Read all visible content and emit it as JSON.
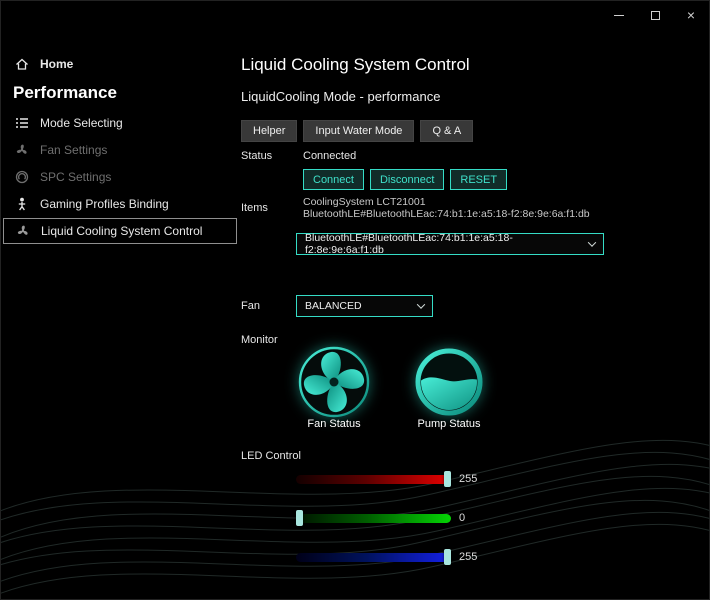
{
  "window": {
    "controls": {
      "minimize": "minimize",
      "maximize": "maximize",
      "close": "×"
    }
  },
  "sidebar": {
    "home_label": "Home",
    "section_title": "Performance",
    "items": [
      {
        "label": "Mode Selecting",
        "state": "normal"
      },
      {
        "label": "Fan Settings",
        "state": "disabled"
      },
      {
        "label": "SPC Settings",
        "state": "disabled"
      },
      {
        "label": "Gaming Profiles Binding",
        "state": "normal"
      },
      {
        "label": "Liquid Cooling System Control",
        "state": "selected"
      }
    ]
  },
  "main": {
    "title": "Liquid Cooling System Control",
    "subtitle": "LiquidCooling Mode - performance",
    "toolbar": {
      "helper": "Helper",
      "input_water_mode": "Input Water Mode",
      "qa": "Q & A"
    },
    "status": {
      "label": "Status",
      "value": "Connected",
      "connect": "Connect",
      "disconnect": "Disconnect",
      "reset": "RESET"
    },
    "items": {
      "label": "Items",
      "line1": "CoolingSystem LCT21001",
      "line2": "BluetoothLE#BluetoothLEac:74:b1:1e:a5:18-f2:8e:9e:6a:f1:db",
      "selected_device": "BluetoothLE#BluetoothLEac:74:b1:1e:a5:18-f2:8e:9e:6a:f1:db"
    },
    "fan": {
      "label": "Fan",
      "selected": "BALANCED"
    },
    "monitor": {
      "label": "Monitor",
      "fan_status_label": "Fan Status",
      "pump_status_label": "Pump Status"
    },
    "led": {
      "label": "LED Control",
      "sliders": [
        {
          "channel": "red",
          "value": 255,
          "max": 255
        },
        {
          "channel": "green",
          "value": 0,
          "max": 255
        },
        {
          "channel": "blue",
          "value": 255,
          "max": 255
        }
      ]
    }
  },
  "colors": {
    "accent": "#35dcc6",
    "background": "#000000",
    "button_gray": "#383838",
    "red_end": "#e60000",
    "green_end": "#04d404",
    "blue_end": "#1420e8"
  }
}
